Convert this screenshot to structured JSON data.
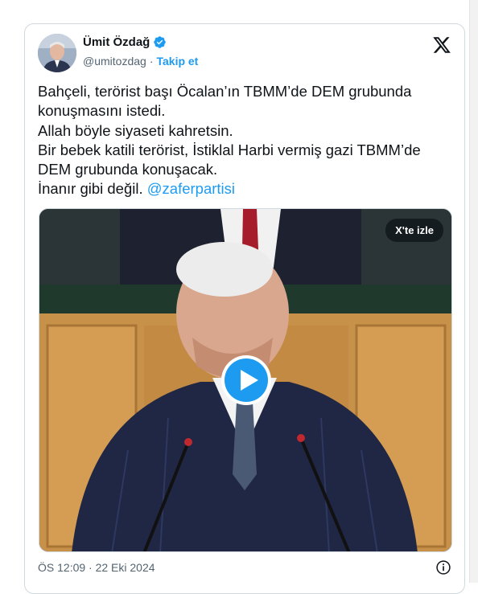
{
  "author": {
    "name": "Ümit Özdağ",
    "handle": "@umitozdag",
    "separator": "·",
    "follow_label": "Takip et"
  },
  "tweet": {
    "lines": [
      "Bahçeli, terörist başı Öcalan’ın TBMM’de DEM grubunda",
      "konuşmasını istedi.",
      "Allah böyle siyaseti kahretsin.",
      "Bir bebek katili terörist, İstiklal Harbi vermiş gazi TBMM’de",
      "DEM grubunda konuşacak.",
      "İnanır gibi değil."
    ],
    "mention": "@zaferpartisi"
  },
  "video": {
    "watch_label": "X'te izle"
  },
  "footer": {
    "timestamp": "ÖS 12:09 · 22 Eki 2024"
  },
  "icons": {
    "verified": "verified-badge-icon",
    "platform": "x-logo-icon",
    "play": "play-icon",
    "info": "info-icon"
  },
  "colors": {
    "accent": "#1d9bf0",
    "text": "#0f1419",
    "secondary": "#536471",
    "border": "#cfd9de"
  }
}
